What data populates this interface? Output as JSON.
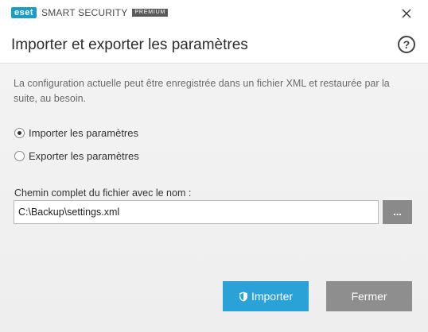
{
  "window": {
    "brand": "eset",
    "product": "SMART SECURITY",
    "edition": "PREMIUM",
    "brand_color": "#1b9cc4",
    "close_icon": "close-icon"
  },
  "header": {
    "title": "Importer et exporter les paramètres",
    "help_label": "?",
    "help_icon": "help-icon"
  },
  "description": "La configuration actuelle peut être enregistrée dans un fichier XML et restaurée par la suite, au besoin.",
  "options": [
    {
      "label": "Importer les paramètres",
      "selected": true
    },
    {
      "label": "Exporter les paramètres",
      "selected": false
    }
  ],
  "path": {
    "label": "Chemin complet du fichier avec le nom :",
    "value": "C:\\Backup\\settings.xml",
    "browse_label": "..."
  },
  "buttons": {
    "primary_label": "Importer",
    "primary_icon": "shield-icon",
    "primary_color": "#2aa2d8",
    "secondary_label": "Fermer",
    "secondary_color": "#8e8e8e"
  }
}
